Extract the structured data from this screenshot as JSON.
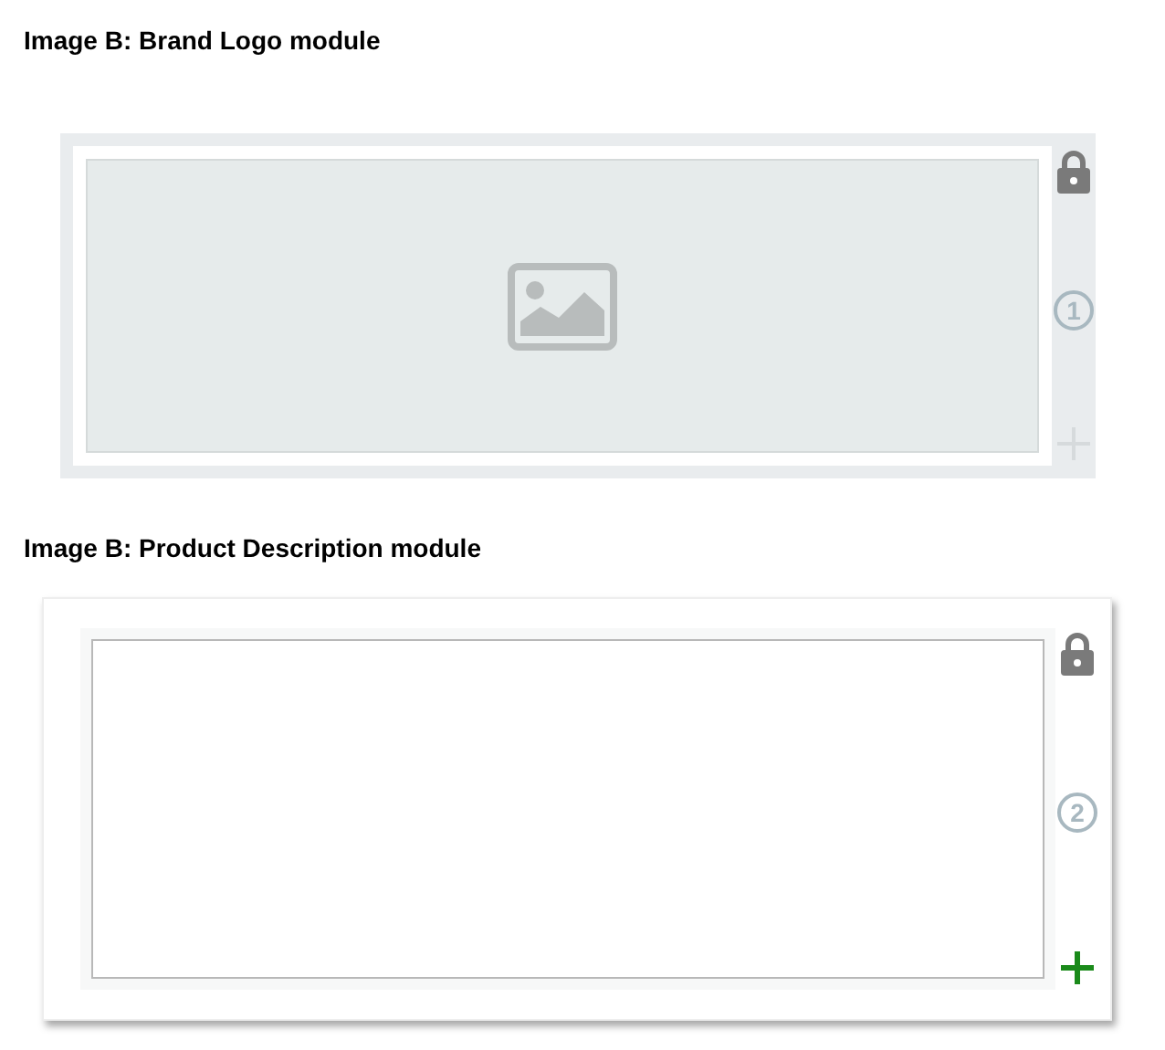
{
  "sections": [
    {
      "heading": "Image B: Brand Logo module",
      "module": {
        "kind": "image",
        "number": "1",
        "add_disabled": true
      }
    },
    {
      "heading": "Image B: Product Description module",
      "module": {
        "kind": "text",
        "number": "2",
        "add_disabled": false
      }
    }
  ]
}
